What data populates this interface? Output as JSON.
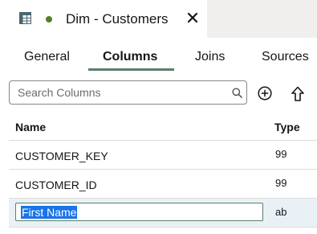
{
  "document_tab": {
    "title": "Dim - Customers",
    "icon": "table-grid-icon",
    "modified_indicator_color": "#508223"
  },
  "subtabs": [
    {
      "label": "General",
      "selected": false
    },
    {
      "label": "Columns",
      "selected": true
    },
    {
      "label": "Joins",
      "selected": false
    },
    {
      "label": "Sources",
      "selected": false
    }
  ],
  "search": {
    "placeholder": "Search Columns",
    "value": ""
  },
  "toolbar": {
    "add_icon": "add-circle-icon",
    "upload_icon": "upload-arrow-icon"
  },
  "table": {
    "headers": {
      "name": "Name",
      "type": "Type"
    },
    "rows": [
      {
        "name": "CUSTOMER_KEY",
        "type": "99",
        "selected": false
      },
      {
        "name": "CUSTOMER_ID",
        "type": "99",
        "selected": false
      },
      {
        "name": "First Name",
        "type": "ab",
        "selected": true,
        "editing": true
      }
    ]
  },
  "colors": {
    "accent": "#5b7f6b",
    "selected_row": "#eaf1f6",
    "text_selection": "#1a73e8"
  }
}
